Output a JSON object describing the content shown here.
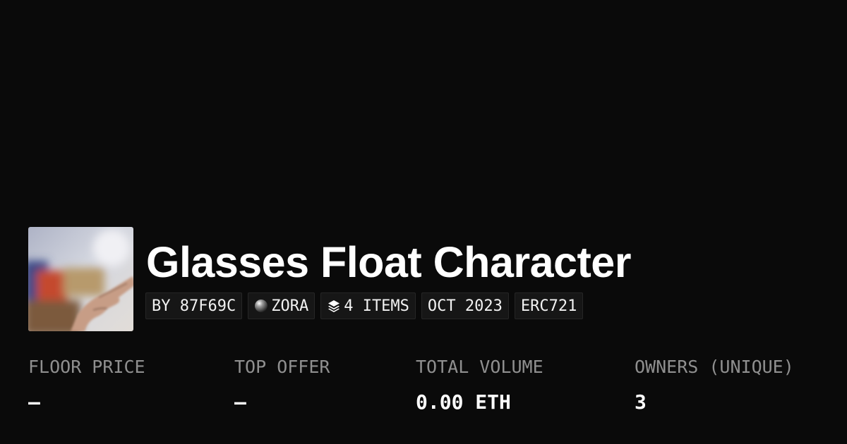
{
  "collection": {
    "title": "Glasses Float Character",
    "tags": [
      {
        "text": "BY 87F69C",
        "icon": null
      },
      {
        "text": "ZORA",
        "icon": "zora-orb-icon"
      },
      {
        "text": "4 ITEMS",
        "icon": "layers-icon"
      },
      {
        "text": "OCT 2023",
        "icon": null
      },
      {
        "text": "ERC721",
        "icon": null
      }
    ]
  },
  "stats": [
    {
      "label": "FLOOR PRICE",
      "value": "–"
    },
    {
      "label": "TOP OFFER",
      "value": "–"
    },
    {
      "label": "TOTAL VOLUME",
      "value": "0.00 ETH"
    },
    {
      "label": "OWNERS (UNIQUE)",
      "value": "3"
    }
  ],
  "colors": {
    "background": "#0a0a0a",
    "text": "#ffffff",
    "label": "#8f8f8f",
    "tag_background": "#161616",
    "tag_border": "#262626"
  }
}
